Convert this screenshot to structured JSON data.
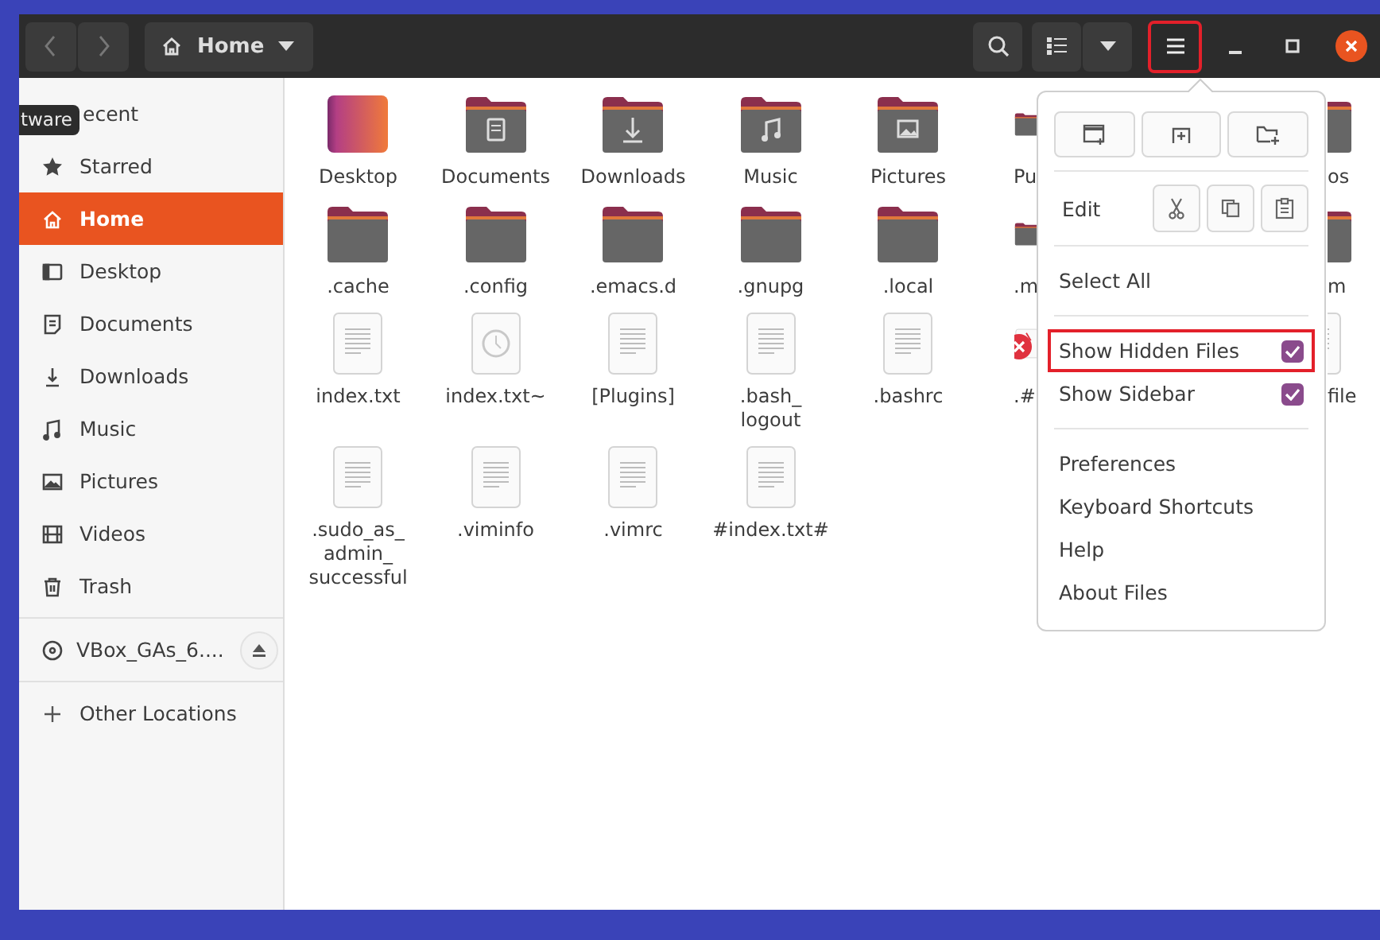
{
  "header": {
    "path_button": {
      "label": "Home"
    }
  },
  "sidebar": {
    "items": [
      {
        "label": "ecent",
        "selected": false,
        "tooltip": "tware"
      },
      {
        "label": "Starred",
        "kind": "starred",
        "selected": false
      },
      {
        "label": "Home",
        "kind": "home",
        "selected": true
      },
      {
        "label": "Desktop",
        "kind": "desktop",
        "selected": false
      },
      {
        "label": "Documents",
        "kind": "documents",
        "selected": false
      },
      {
        "label": "Downloads",
        "kind": "downloads",
        "selected": false
      },
      {
        "label": "Music",
        "kind": "music",
        "selected": false
      },
      {
        "label": "Pictures",
        "kind": "pictures",
        "selected": false
      },
      {
        "label": "Videos",
        "kind": "videos",
        "selected": false
      },
      {
        "label": "Trash",
        "kind": "trash",
        "selected": false
      }
    ],
    "devices": [
      {
        "label": "VBox_GAs_6....",
        "kind": "disc",
        "ejectable": true
      }
    ],
    "other": {
      "label": "Other Locations"
    }
  },
  "files": {
    "rows": [
      {
        "items": [
          {
            "kind": "desktop",
            "label": "Desktop"
          },
          {
            "kind": "documents",
            "label": "Documents"
          },
          {
            "kind": "downloads",
            "label": "Downloads"
          },
          {
            "kind": "music",
            "label": "Music"
          },
          {
            "kind": "pictures",
            "label": "Pictures"
          }
        ],
        "behind_menu_left": {
          "kind": "folder",
          "label": "Pu"
        },
        "behind_menu_right": {
          "kind": "folder",
          "label": "os"
        }
      },
      {
        "items": [
          {
            "kind": "folder",
            "label": ".cache"
          },
          {
            "kind": "folder",
            "label": ".config"
          },
          {
            "kind": "folder",
            "label": ".emacs.d"
          },
          {
            "kind": "folder",
            "label": ".gnupg"
          },
          {
            "kind": "folder",
            "label": ".local"
          }
        ],
        "behind_menu_left": {
          "kind": "folder",
          "label": ".m"
        },
        "behind_menu_right": {
          "kind": "folder",
          "label": "m"
        }
      },
      {
        "items": [
          {
            "kind": "text",
            "label": "index.txt"
          },
          {
            "kind": "backup",
            "label": "index.txt~"
          },
          {
            "kind": "text",
            "label": "[Plugins]"
          },
          {
            "kind": "text",
            "label": ".bash_ logout"
          },
          {
            "kind": "text",
            "label": ".bashrc"
          }
        ],
        "behind_menu_left": {
          "kind": "broken",
          "label": ".#"
        },
        "behind_menu_right": {
          "kind": "text",
          "label": "file"
        }
      },
      {
        "items": [
          {
            "kind": "text",
            "label": ".sudo_as_ admin_ successful"
          },
          {
            "kind": "text",
            "label": ".viminfo"
          },
          {
            "kind": "text",
            "label": ".vimrc"
          },
          {
            "kind": "text",
            "label": "#index.txt#"
          }
        ]
      }
    ]
  },
  "menu": {
    "edit_label": "Edit",
    "sections": [
      [
        {
          "label": "Select All",
          "kind": "plain"
        }
      ],
      [
        {
          "label": "Show Hidden Files",
          "kind": "check",
          "checked": true,
          "highlighted": true
        },
        {
          "label": "Show Sidebar",
          "kind": "check",
          "checked": true,
          "highlighted": false
        }
      ],
      [
        {
          "label": "Preferences",
          "kind": "plain"
        },
        {
          "label": "Keyboard Shortcuts",
          "kind": "plain"
        },
        {
          "label": "Help",
          "kind": "plain"
        },
        {
          "label": "About Files",
          "kind": "plain"
        }
      ]
    ]
  },
  "menu_button": {
    "highlighted": true
  }
}
